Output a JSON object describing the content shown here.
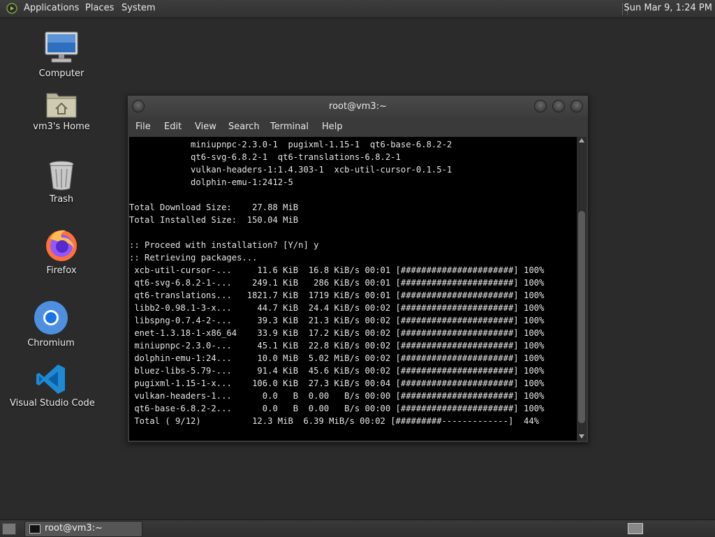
{
  "top_panel": {
    "menus": [
      "Applications",
      "Places",
      "System"
    ],
    "clock": "Sun Mar  9,  1:24 PM"
  },
  "desktop_icons": [
    {
      "label": "Computer",
      "icon": "computer-icon"
    },
    {
      "label": "vm3's Home",
      "icon": "home-folder-icon"
    },
    {
      "label": "Trash",
      "icon": "trash-icon"
    },
    {
      "label": "Firefox",
      "icon": "firefox-icon"
    },
    {
      "label": "Chromium",
      "icon": "chromium-icon"
    },
    {
      "label": "Visual Studio Code",
      "icon": "vscode-icon"
    }
  ],
  "terminal": {
    "title": "root@vm3:~",
    "menu": [
      "File",
      "Edit",
      "View",
      "Search",
      "Terminal",
      "Help"
    ],
    "lines": [
      "            miniupnpc-2.3.0-1  pugixml-1.15-1  qt6-base-6.8.2-2",
      "            qt6-svg-6.8.2-1  qt6-translations-6.8.2-1",
      "            vulkan-headers-1:1.4.303-1  xcb-util-cursor-0.1.5-1",
      "            dolphin-emu-1:2412-5",
      "",
      "Total Download Size:    27.88 MiB",
      "Total Installed Size:  150.04 MiB",
      "",
      ":: Proceed with installation? [Y/n] y",
      ":: Retrieving packages...",
      " xcb-util-cursor-...     11.6 KiB  16.8 KiB/s 00:01 [######################] 100%",
      " qt6-svg-6.8.2-1-...    249.1 KiB   286 KiB/s 00:01 [######################] 100%",
      " qt6-translations...   1821.7 KiB  1719 KiB/s 00:01 [######################] 100%",
      " libb2-0.98.1-3-x...     44.7 KiB  24.4 KiB/s 00:02 [######################] 100%",
      " libspng-0.7.4-2-...     39.3 KiB  21.3 KiB/s 00:02 [######################] 100%",
      " enet-1.3.18-1-x86_64    33.9 KiB  17.2 KiB/s 00:02 [######################] 100%",
      " miniupnpc-2.3.0-...     45.1 KiB  22.8 KiB/s 00:02 [######################] 100%",
      " dolphin-emu-1:24...     10.0 MiB  5.02 MiB/s 00:02 [######################] 100%",
      " bluez-libs-5.79-...     91.4 KiB  45.6 KiB/s 00:02 [######################] 100%",
      " pugixml-1.15-1-x...    106.0 KiB  27.3 KiB/s 00:04 [######################] 100%",
      " vulkan-headers-1...      0.0   B  0.00   B/s 00:00 [######################] 100%",
      " qt6-base-6.8.2-2...      0.0   B  0.00   B/s 00:00 [######################] 100%",
      " Total ( 9/12)          12.3 MiB  6.39 MiB/s 00:02 [#########-------------]  44%"
    ]
  },
  "taskbar": {
    "task_label": "root@vm3:~"
  },
  "colors": {
    "desktop_bg": "#2b2b2b",
    "terminal_bg": "#000000",
    "panel_bg": "#363636"
  }
}
